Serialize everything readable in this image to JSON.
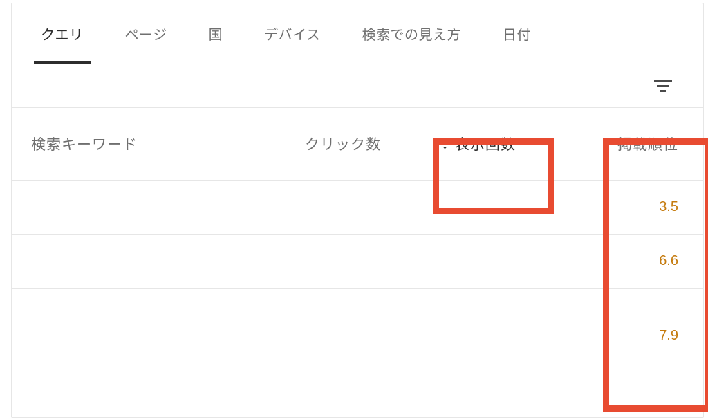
{
  "tabs": [
    {
      "label": "クエリ",
      "active": true
    },
    {
      "label": "ページ",
      "active": false
    },
    {
      "label": "国",
      "active": false
    },
    {
      "label": "デバイス",
      "active": false
    },
    {
      "label": "検索での見え方",
      "active": false
    },
    {
      "label": "日付",
      "active": false
    }
  ],
  "columns": {
    "keyword": "検索キーワード",
    "clicks": "クリック数",
    "impressions": "表示回数",
    "position": "掲載順位"
  },
  "sort_arrow": "↓",
  "rows": [
    {
      "position": "3.5"
    },
    {
      "position": "6.6"
    },
    {
      "position": "7.9"
    }
  ]
}
